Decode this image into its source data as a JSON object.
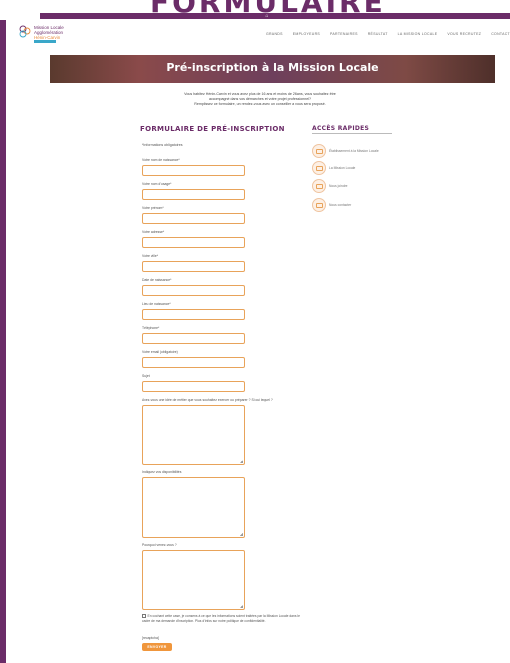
{
  "banner": {
    "ghost_title": "FORMULAIRE"
  },
  "logo": {
    "line1": "Mission Locale",
    "line2": "Agglomération",
    "line3": "Hénin-Carvin"
  },
  "nav": [
    "Grands",
    "Employeurs",
    "Partenaires",
    "Résultat",
    "La Mission Locale",
    "Vous recrutez",
    "Contact"
  ],
  "hero": {
    "title": "Pré-inscription à la Mission Locale"
  },
  "intro": {
    "lines": [
      "Vous habitez Hénin-Carvin et vous avez plus de 16 ans et moins de 26ans, vous souhaitez être",
      "accompagné dans vos démarches et votre projet professionnel?",
      "Remplissez ce formulaire, un rendez-vous avec un conseiller a vous sera proposé."
    ]
  },
  "form": {
    "title": "FORMULAIRE DE PRÉ-INSCRIPTION",
    "note": "*Informations obligatoires",
    "fields": [
      "Votre nom de naissance*",
      "Votre nom d'usage*",
      "Votre prénom*",
      "Votre adresse*",
      "Votre ville*",
      "Date de naissance*",
      "Lieu de naissance*",
      "Téléphone*",
      "Votre email (obligatoire)",
      "Sujet"
    ],
    "textareas": [
      "Avez-vous une idée de métier que vous souhaitez exercer ou préparer ? Si oui lequel ?",
      "Indiquez vos disponibilités",
      "Pourquoi venez-vous ?"
    ],
    "consent": "En cochant cette case, je consens à ce que les informations soient traitées par la Mission Locale dans le cadre de ma demande d'inscription. Plus d'infos sur notre politique de confidentialité.",
    "captcha": "[recaptcha]",
    "submit": "ENVOYER"
  },
  "quick": {
    "title": "ACCÈS RAPIDES",
    "items": [
      "Établissement à la Mission Locale",
      "La Mission Locale",
      "Nous joindre",
      "Nous contacter"
    ]
  }
}
